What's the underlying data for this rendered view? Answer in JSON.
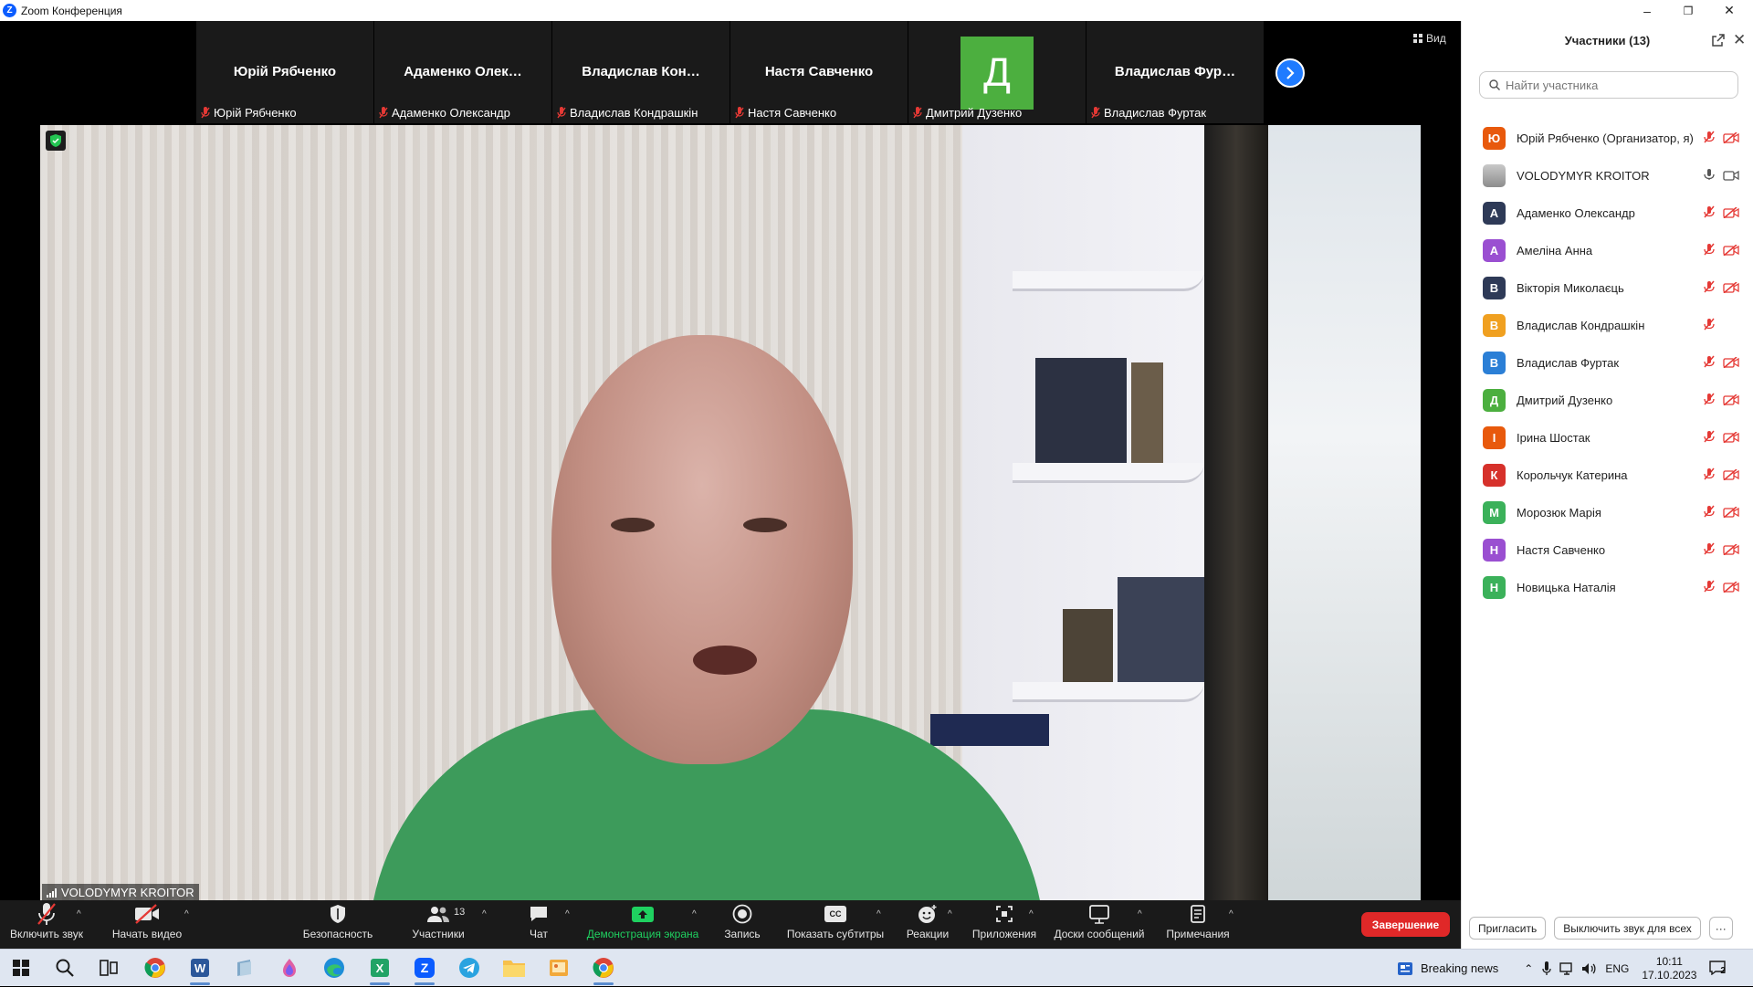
{
  "window": {
    "title": "Zoom Конференция",
    "minimize": "–",
    "restore": "❐",
    "close": "✕"
  },
  "strip": {
    "thumbnails": [
      {
        "display_name": "Юрій Рябченко",
        "caption": "Юрій Рябченко"
      },
      {
        "display_name": "Адаменко Олек…",
        "caption": "Адаменко Олександр"
      },
      {
        "display_name": "Владислав Кон…",
        "caption": "Владислав Кондрашкін"
      },
      {
        "display_name": "Настя Савченко",
        "caption": "Настя Савченко"
      },
      {
        "avatar_letter": "Д",
        "avatar_color": "#4caf3f",
        "caption": "Дмитрий Дузенко"
      },
      {
        "display_name": "Владислав Фур…",
        "caption": "Владислав Фуртак"
      }
    ],
    "view_label": "Вид"
  },
  "main_video": {
    "speaker_name": "VOLODYMYR KROITOR"
  },
  "toolbar": {
    "unmute": "Включить звук",
    "start_video": "Начать видео",
    "security": "Безопасность",
    "participants": "Участники",
    "participants_count": "13",
    "chat": "Чат",
    "share_screen": "Демонстрация экрана",
    "record": "Запись",
    "captions": "Показать субтитры",
    "captions_icon_text": "CC",
    "reactions": "Реакции",
    "apps": "Приложения",
    "whiteboards": "Доски сообщений",
    "notes": "Примечания",
    "end": "Завершение",
    "share_color": "#1fd160",
    "end_color": "#e02828"
  },
  "panel": {
    "title": "Участники (13)",
    "search_placeholder": "Найти участника",
    "invite": "Пригласить",
    "mute_all": "Выключить звук для всех",
    "more": "···",
    "participants": [
      {
        "letter": "Ю",
        "color": "#e8590c",
        "name": "Юрій Рябченко (Организатор, я)",
        "mic": "muted",
        "cam": "off"
      },
      {
        "letter": "",
        "color": "photo",
        "name": "VOLODYMYR KROITOR",
        "mic": "on",
        "cam": "on"
      },
      {
        "letter": "А",
        "color": "#2e3a57",
        "name": "Адаменко Олександр",
        "mic": "muted",
        "cam": "off"
      },
      {
        "letter": "А",
        "color": "#9a4fd1",
        "name": "Амеліна Анна",
        "mic": "muted",
        "cam": "off"
      },
      {
        "letter": "В",
        "color": "#2e3a57",
        "name": "Вікторія Миколаєць",
        "mic": "muted",
        "cam": "off"
      },
      {
        "letter": "В",
        "color": "#f0a020",
        "name": "Владислав Кондрашкін",
        "mic": "muted",
        "cam": "none"
      },
      {
        "letter": "В",
        "color": "#2b7fd6",
        "name": "Владислав Фуртак",
        "mic": "muted",
        "cam": "off"
      },
      {
        "letter": "Д",
        "color": "#4caf3f",
        "name": "Дмитрий Дузенко",
        "mic": "muted",
        "cam": "off"
      },
      {
        "letter": "І",
        "color": "#e8590c",
        "name": "Ірина Шостак",
        "mic": "muted",
        "cam": "off"
      },
      {
        "letter": "К",
        "color": "#d6312b",
        "name": "Корольчук Катерина",
        "mic": "muted",
        "cam": "off"
      },
      {
        "letter": "М",
        "color": "#3bb15a",
        "name": "Морозюк Марія",
        "mic": "muted",
        "cam": "off"
      },
      {
        "letter": "Н",
        "color": "#9a4fd1",
        "name": "Настя Савченко",
        "mic": "muted",
        "cam": "off"
      },
      {
        "letter": "Н",
        "color": "#3bb15a",
        "name": "Новицька Наталія",
        "mic": "muted",
        "cam": "off"
      }
    ]
  },
  "taskbar": {
    "news": "Breaking news",
    "lang": "ENG",
    "time": "10:11",
    "date": "17.10.2023",
    "notif_count": "2",
    "apps": [
      "windows-start",
      "search",
      "task-view",
      "chrome",
      "word",
      "files-app",
      "paint-app",
      "edge",
      "excel",
      "zoom",
      "telegram",
      "file-explorer",
      "image-viewer",
      "chrome"
    ]
  }
}
